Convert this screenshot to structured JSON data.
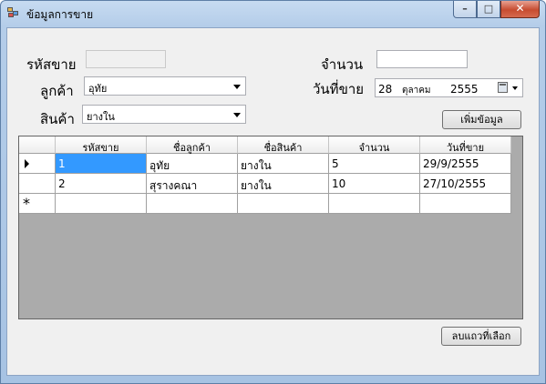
{
  "window": {
    "title": "ข้อมูลการขาย",
    "minimize_glyph": "–",
    "maximize_glyph": "□",
    "close_glyph": "✕"
  },
  "form": {
    "sale_id_label": "รหัสขาย",
    "sale_id_value": "",
    "customer_label": "ลูกค้า",
    "customer_selected": "อุทัย",
    "product_label": "สินค้า",
    "product_selected": "ยางใน",
    "quantity_label": "จำนวน",
    "quantity_value": "",
    "sale_date_label": "วันที่ขาย",
    "sale_date_day": "28",
    "sale_date_month": "ตุลาคม",
    "sale_date_year": "2555"
  },
  "buttons": {
    "add_label": "เพิ่มข้อมูล",
    "delete_label": "ลบแถวที่เลือก"
  },
  "grid": {
    "columns": [
      "รหัสขาย",
      "ชื่อลูกค้า",
      "ชื่อสินค้า",
      "จำนวน",
      "วันที่ขาย"
    ],
    "rows": [
      [
        "1",
        "อุทัย",
        "ยางใน",
        "5",
        "29/9/2555"
      ],
      [
        "2",
        "สุรางคณา",
        "ยางใน",
        "10",
        "27/10/2555"
      ]
    ],
    "new_row_marker": "*",
    "selected_cell": [
      0,
      0
    ]
  },
  "colors": {
    "selection": "#3399ff",
    "grid_background": "#ababab",
    "client_background": "#f0f0f0"
  }
}
